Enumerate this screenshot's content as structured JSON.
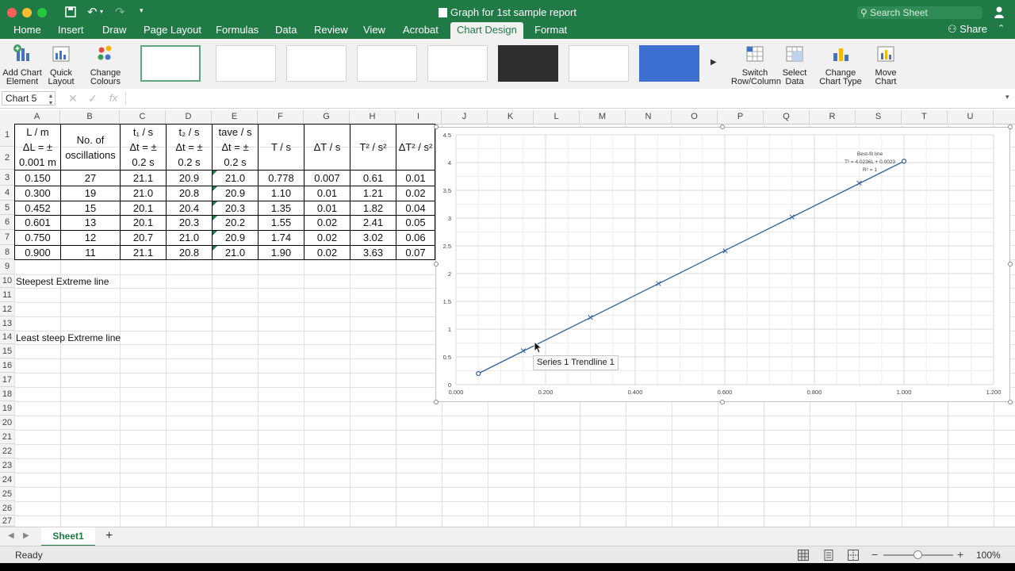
{
  "window": {
    "title": "Graph for 1st sample report",
    "search_placeholder": "Search Sheet",
    "share_label": "Share"
  },
  "tabs": [
    {
      "label": "Home"
    },
    {
      "label": "Insert"
    },
    {
      "label": "Draw"
    },
    {
      "label": "Page Layout"
    },
    {
      "label": "Formulas"
    },
    {
      "label": "Data"
    },
    {
      "label": "Review"
    },
    {
      "label": "View"
    },
    {
      "label": "Acrobat"
    },
    {
      "label": "Chart Design"
    },
    {
      "label": "Format"
    }
  ],
  "ribbon": {
    "add_chart_element": [
      "Add Chart",
      "Element"
    ],
    "quick_layout": [
      "Quick",
      "Layout"
    ],
    "change_colours": [
      "Change",
      "Colours"
    ],
    "switch_row_column": [
      "Switch",
      "Row/Column"
    ],
    "select_data": [
      "Select",
      "Data"
    ],
    "change_chart_type": [
      "Change",
      "Chart Type"
    ],
    "move_chart": [
      "Move",
      "Chart"
    ]
  },
  "formula_bar": {
    "name_box": "Chart 5",
    "fx": "fx"
  },
  "columns": [
    "A",
    "B",
    "C",
    "D",
    "E",
    "F",
    "G",
    "H",
    "I",
    "J",
    "K",
    "L",
    "M",
    "N",
    "O",
    "P",
    "Q",
    "R",
    "S",
    "T",
    "U"
  ],
  "rows": [
    "1",
    "2",
    "3",
    "4",
    "5",
    "6",
    "7",
    "8",
    "9",
    "10",
    "11",
    "12",
    "13",
    "14",
    "15",
    "16",
    "17",
    "18",
    "19",
    "20",
    "21",
    "22",
    "23",
    "24",
    "25",
    "26",
    "27"
  ],
  "table_header": {
    "a": [
      "L / m",
      "ΔL = ±",
      "0.001 m"
    ],
    "b": [
      "No. of",
      "oscillations"
    ],
    "c": [
      "t₁ / s",
      "Δt = ±",
      "0.2 s"
    ],
    "d": [
      "t₂ / s",
      "Δt = ±",
      "0.2 s"
    ],
    "e": [
      "tave / s",
      "Δt = ±",
      "0.2 s"
    ],
    "f": "T / s",
    "g": "ΔT / s",
    "h": "T² / s²",
    "i": "ΔT² / s²"
  },
  "table_rows": [
    [
      "0.150",
      "27",
      "21.1",
      "20.9",
      "21.0",
      "0.778",
      "0.007",
      "0.61",
      "0.01"
    ],
    [
      "0.300",
      "19",
      "21.0",
      "20.8",
      "20.9",
      "1.10",
      "0.01",
      "1.21",
      "0.02"
    ],
    [
      "0.452",
      "15",
      "20.1",
      "20.4",
      "20.3",
      "1.35",
      "0.01",
      "1.82",
      "0.04"
    ],
    [
      "0.601",
      "13",
      "20.1",
      "20.3",
      "20.2",
      "1.55",
      "0.02",
      "2.41",
      "0.05"
    ],
    [
      "0.750",
      "12",
      "20.7",
      "21.0",
      "20.9",
      "1.74",
      "0.02",
      "3.02",
      "0.06"
    ],
    [
      "0.900",
      "11",
      "21.1",
      "20.8",
      "21.0",
      "1.90",
      "0.02",
      "3.63",
      "0.07"
    ]
  ],
  "labels": {
    "steepest": "Steepest Extreme line",
    "least_steep": "Least steep Extreme line"
  },
  "chart_data": {
    "type": "scatter",
    "x_ticks": [
      "0.000",
      "0.200",
      "0.400",
      "0.600",
      "0.800",
      "1.000",
      "1.200"
    ],
    "y_ticks": [
      "0",
      "0.5",
      "1",
      "1.5",
      "2",
      "2.5",
      "3",
      "3.5",
      "4",
      "4.5"
    ],
    "xlim": [
      0,
      1.2
    ],
    "ylim": [
      0,
      4.5
    ],
    "grid": true,
    "series": [
      {
        "x": [
          0.15,
          0.3,
          0.452,
          0.601,
          0.75,
          0.9
        ],
        "y": [
          0.61,
          1.21,
          1.82,
          2.41,
          3.02,
          3.63
        ],
        "marker": "x"
      },
      {
        "x": [
          0.05,
          1.0
        ],
        "y": [
          0.2,
          4.025
        ],
        "marker": "circle"
      }
    ],
    "annotation": [
      "Best-fit line",
      "T² = 4.0236L + 0.0023",
      "R² = 1"
    ],
    "tooltip": "Series 1 Trendline 1",
    "line_color": "#2f5f9e"
  },
  "sheet": {
    "tab": "Sheet1",
    "add": "+"
  },
  "status": {
    "ready": "Ready",
    "zoom": "100%"
  },
  "colors": {
    "excel_green": "#1f7a45"
  }
}
